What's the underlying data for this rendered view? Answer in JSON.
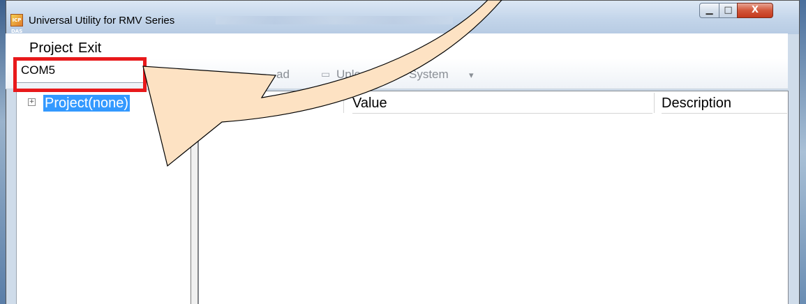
{
  "window": {
    "title": "Universal Utility for RMV Series",
    "app_icon_text": "ICP DAS",
    "controls": {
      "minimize": "▁",
      "maximize": "□",
      "close": "X"
    }
  },
  "menubar": {
    "items": [
      "Project",
      "Exit"
    ]
  },
  "toolbar": {
    "port_combo_value": "COM5",
    "buttons": [
      {
        "label": "ad",
        "icon": "download-icon"
      },
      {
        "label": "Upload",
        "icon": "upload-icon"
      },
      {
        "label": "System",
        "icon": "star-icon"
      }
    ],
    "system_dropdown_glyph": "▾"
  },
  "tree": {
    "expander": "+",
    "root_label": "Project(none)"
  },
  "list": {
    "columns": [
      "Value",
      "Description"
    ]
  },
  "annotation": {
    "highlight_color": "#e8191b",
    "callout_fill": "#fde2c3"
  }
}
